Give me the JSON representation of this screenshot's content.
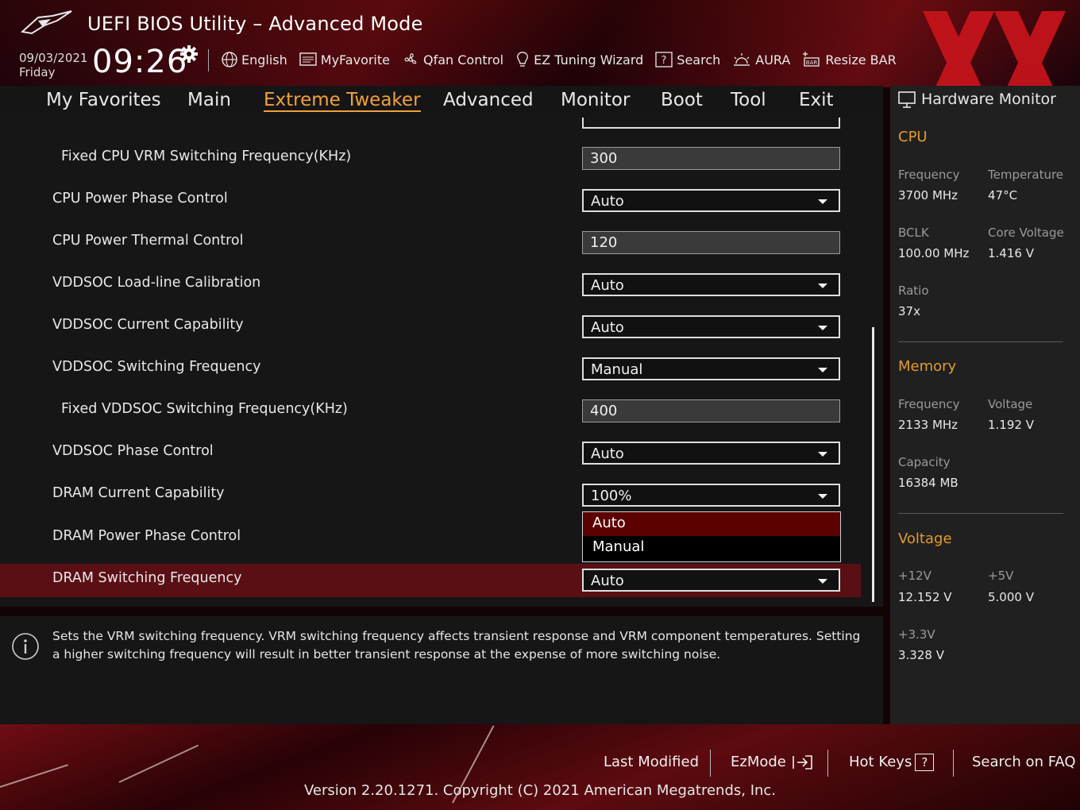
{
  "header": {
    "title": "UEFI BIOS Utility – Advanced Mode",
    "date": "09/03/2021",
    "day": "Friday",
    "time": "09:26",
    "tools": [
      {
        "label": "English",
        "icon": "globe-icon"
      },
      {
        "label": "MyFavorite",
        "icon": "favorite-list-icon"
      },
      {
        "label": "Qfan Control",
        "icon": "fan-icon"
      },
      {
        "label": "EZ Tuning Wizard",
        "icon": "lightbulb-icon"
      },
      {
        "label": "Search",
        "icon": "question-box-icon"
      },
      {
        "label": "AURA",
        "icon": "aura-icon"
      },
      {
        "label": "Resize BAR",
        "icon": "resize-bar-icon"
      }
    ]
  },
  "nav": {
    "tabs": [
      "My Favorites",
      "Main",
      "Extreme Tweaker",
      "Advanced",
      "Monitor",
      "Boot",
      "Tool",
      "Exit"
    ],
    "active": "Extreme Tweaker"
  },
  "settings": [
    {
      "label": "Fixed CPU VRM Switching Frequency(KHz)",
      "value": "300",
      "type": "input"
    },
    {
      "label": "CPU Power Phase Control",
      "value": "Auto",
      "type": "dropdown"
    },
    {
      "label": "CPU Power Thermal Control",
      "value": "120",
      "type": "input"
    },
    {
      "label": "VDDSOC Load-line Calibration",
      "value": "Auto",
      "type": "dropdown"
    },
    {
      "label": "VDDSOC Current Capability",
      "value": "Auto",
      "type": "dropdown"
    },
    {
      "label": "VDDSOC Switching Frequency",
      "value": "Manual",
      "type": "dropdown"
    },
    {
      "label": "Fixed VDDSOC Switching Frequency(KHz)",
      "value": "400",
      "type": "input"
    },
    {
      "label": "VDDSOC Phase Control",
      "value": "Auto",
      "type": "dropdown"
    },
    {
      "label": "DRAM Current Capability",
      "value": "100%",
      "type": "dropdown"
    },
    {
      "label": "DRAM Power Phase Control",
      "value": "",
      "type": "dropdown"
    },
    {
      "label": "DRAM Switching Frequency",
      "value": "Auto",
      "type": "dropdown"
    }
  ],
  "popup": {
    "options": [
      "Auto",
      "Manual"
    ],
    "highlighted": "Auto"
  },
  "info": {
    "text": "Sets the VRM switching frequency.  VRM switching frequency affects transient response and VRM component temperatures. Setting a higher switching frequency will result in better transient response at the expense of more switching noise."
  },
  "hardware_monitor": {
    "title": "Hardware Monitor",
    "cpu": {
      "heading": "CPU",
      "frequency_label": "Frequency",
      "frequency": "3700 MHz",
      "temperature_label": "Temperature",
      "temperature": "47°C",
      "bclk_label": "BCLK",
      "bclk": "100.00 MHz",
      "core_voltage_label": "Core Voltage",
      "core_voltage": "1.416 V",
      "ratio_label": "Ratio",
      "ratio": "37x"
    },
    "memory": {
      "heading": "Memory",
      "frequency_label": "Frequency",
      "frequency": "2133 MHz",
      "voltage_label": "Voltage",
      "voltage": "1.192 V",
      "capacity_label": "Capacity",
      "capacity": "16384 MB"
    },
    "voltage": {
      "heading": "Voltage",
      "v12_label": "+12V",
      "v12": "12.152 V",
      "v5_label": "+5V",
      "v5": "5.000 V",
      "v33_label": "+3.3V",
      "v33": "3.328 V"
    }
  },
  "footer": {
    "last_modified": "Last Modified",
    "ezmode": "EzMode",
    "hot_keys": "Hot Keys",
    "hot_keys_key": "?",
    "search_faq": "Search on FAQ",
    "version": "Version 2.20.1271. Copyright (C) 2021 American Megatrends, Inc."
  },
  "colors": {
    "accent": "#f2a13a",
    "section": "#e39a2c",
    "highlight_row": "#5a0f14",
    "popup_highlight": "#5c0000"
  }
}
